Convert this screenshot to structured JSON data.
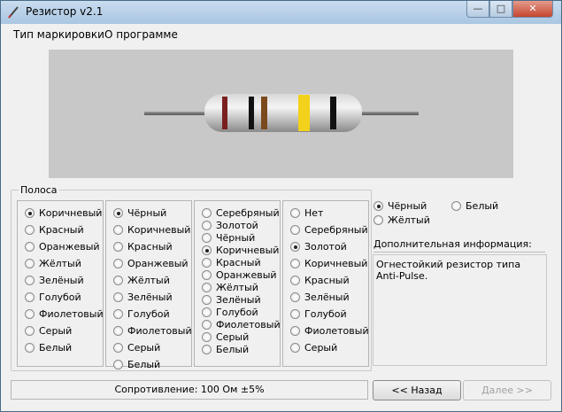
{
  "window": {
    "title": "Резистор v2.1"
  },
  "titlebar": {
    "minimize": "—",
    "maximize": "□",
    "close": "✕"
  },
  "menu": [
    "Тип маркировки",
    "О программе"
  ],
  "resistor": {
    "body_color": "#b4b4b4",
    "band_colors": [
      "#7a1f1f",
      "#111111",
      "#7b4a1c",
      "#f2d21a",
      "#111111"
    ]
  },
  "group_label": "Полоса",
  "columns": [
    {
      "options": [
        "Коричневый",
        "Красный",
        "Оранжевый",
        "Жёлтый",
        "Зелёный",
        "Голубой",
        "Фиолетовый",
        "Серый",
        "Белый"
      ],
      "selected": 0
    },
    {
      "options": [
        "Чёрный",
        "Коричневый",
        "Красный",
        "Оранжевый",
        "Жёлтый",
        "Зелёный",
        "Голубой",
        "Фиолетовый",
        "Серый",
        "Белый"
      ],
      "selected": 0
    },
    {
      "options": [
        "Серебряный",
        "Золотой",
        "Чёрный",
        "Коричневый",
        "Красный",
        "Оранжевый",
        "Жёлтый",
        "Зелёный",
        "Голубой",
        "Фиолетовый",
        "Серый",
        "Белый"
      ],
      "selected": 3
    },
    {
      "options": [
        "Нет",
        "Серебряный",
        "Золотой",
        "Коричневый",
        "Красный",
        "Зелёный",
        "Голубой",
        "Фиолетовый",
        "Серый"
      ],
      "selected": 2
    }
  ],
  "body_options": {
    "items": [
      "Чёрный",
      "Белый",
      "Жёлтый"
    ],
    "selected": 0
  },
  "info": {
    "label": "Дополнительная информация:",
    "text": "Огнестойкий резистор типа Anti-Pulse."
  },
  "status": "Сопротивление: 100 Ом ±5%",
  "buttons": {
    "back": "<< Назад",
    "next": "Далее >>"
  }
}
